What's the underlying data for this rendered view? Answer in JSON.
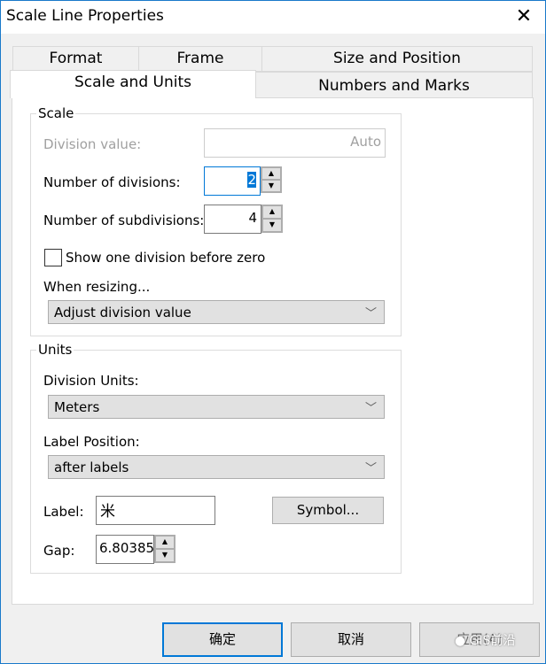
{
  "window": {
    "title": "Scale Line Properties",
    "close_icon": "close-icon"
  },
  "tabs": {
    "row1": [
      {
        "label": "Format"
      },
      {
        "label": "Frame"
      },
      {
        "label": "Size and Position"
      }
    ],
    "row2": [
      {
        "label": "Scale and Units",
        "selected": true
      },
      {
        "label": "Numbers and Marks"
      }
    ]
  },
  "scale": {
    "group_label": "Scale",
    "division_value_label": "Division value:",
    "division_value": "Auto",
    "num_divisions_label": "Number of divisions:",
    "num_divisions": "2",
    "num_subdivisions_label": "Number of subdivisions:",
    "num_subdivisions": "4",
    "show_before_zero_label": "Show one division before zero",
    "show_before_zero": false,
    "when_resizing_label": "When resizing...",
    "when_resizing": "Adjust division value"
  },
  "units": {
    "group_label": "Units",
    "division_units_label": "Division Units:",
    "division_units": "Meters",
    "label_position_label": "Label Position:",
    "label_position": "after labels",
    "label_label": "Label:",
    "label_value": "米",
    "symbol_button": "Symbol...",
    "gap_label": "Gap:",
    "gap_value": "6.80385"
  },
  "buttons": {
    "ok": "确定",
    "cancel": "取消",
    "apply": "应用(A)"
  },
  "watermark": "GIS前沿",
  "colors": {
    "accent": "#0078d7",
    "window_border": "#1979ca"
  }
}
